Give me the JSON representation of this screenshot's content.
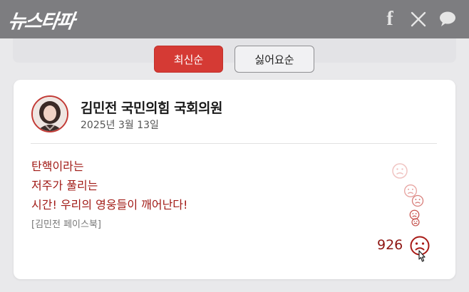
{
  "header": {
    "logo": "뉴스타파",
    "social": [
      "facebook-icon",
      "x-icon",
      "chat-bubble-icon"
    ]
  },
  "tabs": [
    {
      "label": "최신순",
      "active": true
    },
    {
      "label": "싫어요순",
      "active": false
    }
  ],
  "card": {
    "author": "김민전 국민의힘 국회의원",
    "date": "2025년 3월 13일",
    "quote_lines": [
      "탄핵이라는",
      "저주가 풀리는",
      "시간! 우리의 영웅들이 깨어난다!"
    ],
    "source": "[김민전 페이스북]",
    "dislike_count": "926"
  },
  "colors": {
    "accent": "#d53a34",
    "quote": "#a11a16",
    "topbar": "#7d7d80"
  }
}
